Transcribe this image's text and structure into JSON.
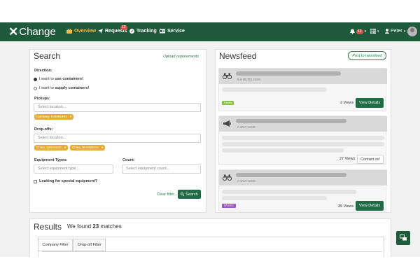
{
  "nav": {
    "logo_text": "Change",
    "items": [
      {
        "label": "Overview",
        "icon": "briefcase-icon"
      },
      {
        "label": "Requests",
        "icon": "send-icon",
        "badge": "12"
      },
      {
        "label": "Tracking",
        "icon": "compass-icon"
      },
      {
        "label": "Service",
        "icon": "id-card-icon"
      }
    ],
    "bell_badge": "12",
    "user_name": "Peter"
  },
  "search": {
    "title": "Search",
    "upload_link": "Upload requirements",
    "direction_label": "Direction:",
    "direction_options": [
      {
        "prefix": "I want to ",
        "bold": "use containers!",
        "selected": true
      },
      {
        "prefix": "I want to ",
        "bold": "supply containers!",
        "selected": false
      }
    ],
    "pickups_label": "Pickups:",
    "pickups_placeholder": "Select location...",
    "pickups_chips": [
      "Germany, HAMBURG"
    ],
    "dropoffs_label": "Drop-offs:",
    "dropoffs_placeholder": "Select location...",
    "dropoffs_chips": [
      "China, QINGDAO",
      "China, SHANGHAI"
    ],
    "equipment_label": "Equipment Types:",
    "equipment_placeholder": "Select equipment type...",
    "count_label": "Count:",
    "count_placeholder": "Select equipment count...",
    "special_label": "Looking for special equipment?",
    "clear_filter": "Clear filter...",
    "search_button": "Search"
  },
  "newsfeed": {
    "title": "Newsfeed",
    "post_button": "Post to newsfeed",
    "items": [
      {
        "icon": "binoculars-icon",
        "time": "5 HOURS AGO",
        "tag": "Carrier",
        "tag_color": "#8bc34a",
        "views": "2 Views",
        "action": "View Details"
      },
      {
        "icon": "megaphone-icon",
        "time": "A DAY AGO",
        "tag": "",
        "tag_color": "",
        "views": "27 Views",
        "action": "Contact us!"
      },
      {
        "icon": "binoculars-icon",
        "time": "A DAY AGO",
        "tag": "NVOCC",
        "tag_color": "#9b59d0",
        "views": "39 Views",
        "action": "View Details"
      }
    ]
  },
  "results": {
    "title": "Results",
    "found_prefix": "We found ",
    "found_count": "23",
    "found_suffix": " matches",
    "tabs": [
      "Company Filter",
      "Drop-off Filter"
    ]
  },
  "colors": {
    "nav_bg": "#1d5a3a",
    "accent_green": "#1f6b45",
    "chip_orange": "#e7a93a",
    "active_nav": "#f0b84a"
  }
}
